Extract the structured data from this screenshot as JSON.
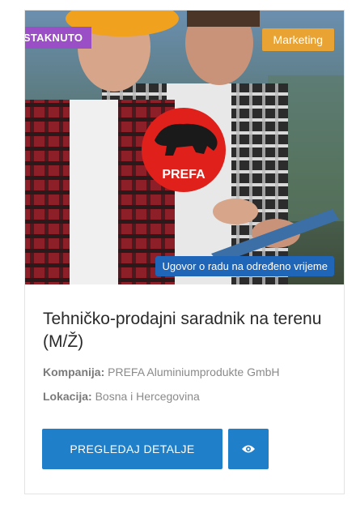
{
  "card": {
    "featured_badge": "ISTAKNUTO",
    "category_badge": "Marketing",
    "contract_badge": "Ugovor o radu na određeno vrijeme",
    "logo_text": "PREFA",
    "title": "Tehničko-prodajni saradnik na terenu (M/Ž)",
    "company_label": "Kompanija:",
    "company_value": "PREFA Aluminiumprodukte GmbH",
    "location_label": "Lokacija:",
    "location_value": "Bosna i Hercegovina",
    "details_button": "PREGLEDAJ DETALJE",
    "view_icon": "eye-icon"
  },
  "colors": {
    "featured": "#9b4fc7",
    "category": "#e9a332",
    "contract": "#1f66b8",
    "button": "#1f7fc8",
    "logo_red": "#e0201b"
  }
}
